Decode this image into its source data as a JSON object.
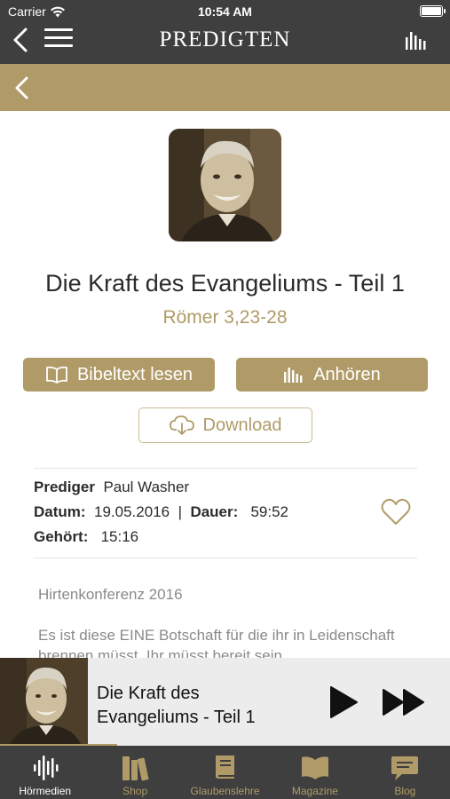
{
  "status_bar": {
    "carrier": "Carrier",
    "time": "10:54 AM"
  },
  "nav": {
    "title": "PREDIGTEN"
  },
  "sermon": {
    "title": "Die Kraft des Evangeliums - Teil 1",
    "verse": "Römer 3,23-28"
  },
  "actions": {
    "bibel_label": "Bibeltext lesen",
    "hoeren_label": "Anhören",
    "download_label": "Download"
  },
  "meta": {
    "prediger_label": "Prediger",
    "prediger_value": "Paul Washer",
    "datum_label": "Datum:",
    "datum_value": "19.05.2016",
    "separator": "|",
    "dauer_label": "Dauer:",
    "dauer_value": "59:52",
    "gehoert_label": "Gehört:",
    "gehoert_value": "15:16"
  },
  "description": {
    "event": "Hirtenkonferenz 2016",
    "text": "Es ist diese EINE Botschaft für die ihr in Leidenschaft brennen müsst. Ihr müsst bereit sein"
  },
  "player": {
    "title_line1": "Die Kraft des",
    "title_line2": "Evangeliums - Teil 1",
    "progress": 0.26
  },
  "tabs": [
    {
      "label": "Hörmedien",
      "icon": "waveform-icon",
      "active": true
    },
    {
      "label": "Shop",
      "icon": "books-icon",
      "active": false
    },
    {
      "label": "Glaubenslehre",
      "icon": "book-icon",
      "active": false
    },
    {
      "label": "Magazine",
      "icon": "open-book-icon",
      "active": false
    },
    {
      "label": "Blog",
      "icon": "chat-icon",
      "active": false
    }
  ],
  "colors": {
    "accent": "#b09b68",
    "dark": "#3f3f3f",
    "text": "#2b2b2b",
    "muted": "#8a8a8a",
    "player_bg": "#ececec"
  }
}
